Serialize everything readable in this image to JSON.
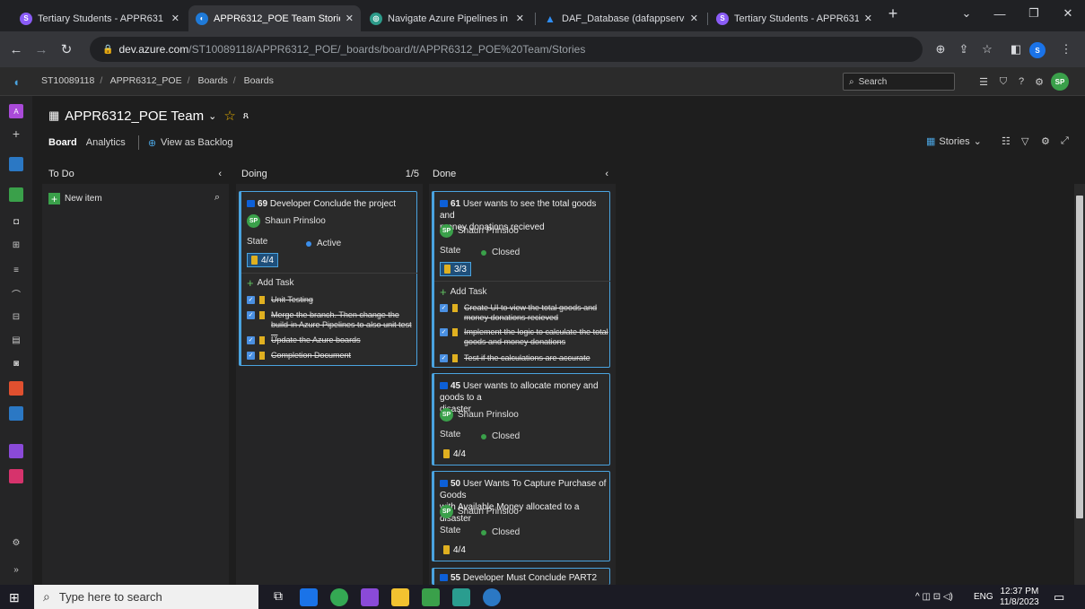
{
  "browser": {
    "tabs": [
      {
        "title": "Tertiary Students - APPR631",
        "active": false
      },
      {
        "title": "APPR6312_POE Team Stories",
        "active": true
      },
      {
        "title": "Navigate Azure Pipelines in",
        "active": false
      },
      {
        "title": "DAF_Database (dafappserve",
        "active": false
      },
      {
        "title": "Tertiary Students - APPR631",
        "active": false
      }
    ],
    "url_host": "dev.azure.com",
    "url_path": "/ST10089118/APPR6312_POE/_boards/board/t/APPR6312_POE%20Team/Stories",
    "profile_initial": "S"
  },
  "header": {
    "breadcrumbs": [
      "ST10089118",
      "APPR6312_POE",
      "Boards",
      "Boards"
    ],
    "search_placeholder": "Search",
    "user_initials": "SP"
  },
  "board": {
    "team_name": "APPR6312_POE Team",
    "pivots": [
      "Board",
      "Analytics"
    ],
    "view_as_backlog": "View as Backlog",
    "backlog_level": "Stories"
  },
  "columns": {
    "todo": {
      "title": "To Do",
      "new_item": "New item"
    },
    "doing": {
      "title": "Doing",
      "wip": "1/5"
    },
    "done": {
      "title": "Done"
    }
  },
  "cards": {
    "c69": {
      "id": "69",
      "title": "Developer Conclude the project",
      "assignee": "Shaun Prinsloo",
      "state_label": "State",
      "state": "Active",
      "tasks_count": "4/4",
      "add_task": "Add Task",
      "tasks": [
        "Unit Testing",
        "Merge the branch. Then change the",
        "build-in Azure Pipelines to also unit test ...",
        "Update the Azure boards",
        "Completion Document"
      ]
    },
    "c61": {
      "id": "61",
      "title_l1": "User wants to see the total goods and",
      "title_l2": "money donations recieved",
      "assignee": "Shaun Prinsloo",
      "state_label": "State",
      "state": "Closed",
      "tasks_count": "3/3",
      "add_task": "Add Task",
      "tasks": [
        "Create UI to view the total goods and",
        "money donations recieved",
        "Implement the logic to calculate the total",
        "goods and money donations",
        "Test if the calculations are accurate"
      ]
    },
    "c45": {
      "id": "45",
      "title_l1": "User wants to allocate money and goods to a",
      "title_l2": "disaster",
      "assignee": "Shaun Prinsloo",
      "state_label": "State",
      "state": "Closed",
      "tasks_count": "4/4"
    },
    "c50": {
      "id": "50",
      "title_l1": "User Wants To Capture Purchase of Goods",
      "title_l2": "with Available Money allocated to a disaster",
      "assignee": "Shaun Prinsloo",
      "state_label": "State",
      "state": "Closed",
      "tasks_count": "4/4"
    },
    "c55": {
      "id": "55",
      "title": "Developer Must Conclude PART2"
    }
  },
  "colors": {
    "accent": "#4aa3df",
    "active": "#3b8eea",
    "closed": "#3aa04a"
  },
  "taskbar": {
    "search_placeholder": "Type here to search",
    "lang": "ENG",
    "time": "12:37 PM",
    "date": "11/8/2023"
  }
}
